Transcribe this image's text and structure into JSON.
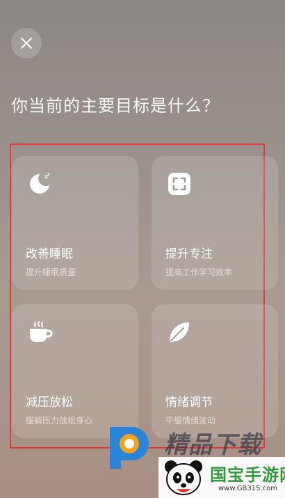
{
  "header": {
    "title": "你当前的主要目标是什么？"
  },
  "cards": [
    {
      "label": "改善睡眠",
      "sub": "提升睡眠质量",
      "icon": "moon-sleep-icon"
    },
    {
      "label": "提升专注",
      "sub": "提高工作学习效率",
      "icon": "focus-frame-icon"
    },
    {
      "label": "减压放松",
      "sub": "缓解压力放松身心",
      "icon": "coffee-cup-icon"
    },
    {
      "label": "情绪调节",
      "sub": "平缓情绪波动",
      "icon": "leaf-icon"
    }
  ],
  "watermarks": {
    "brand1": "精品下载",
    "brand2": "国宝手游网",
    "url": "www.GB315.com"
  },
  "colors": {
    "highlight_border": "#e03a3a",
    "brand_green": "#2e9a3a"
  }
}
